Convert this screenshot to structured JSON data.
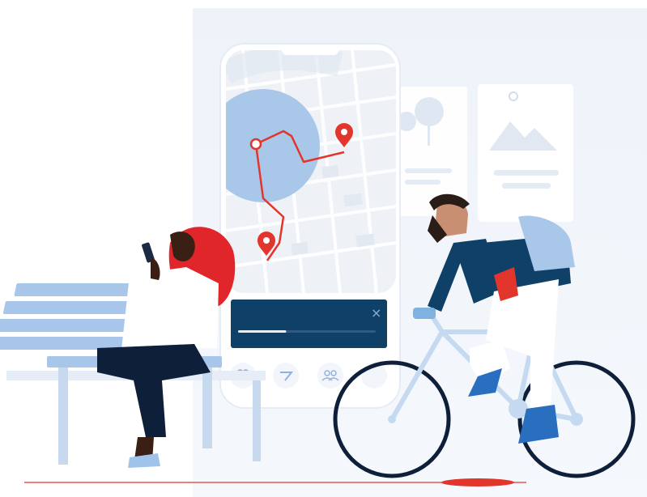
{
  "illustration": {
    "kind": "navigation-app-illustration",
    "route_color": "#e2352c",
    "accent_navy": "#0f4068",
    "light_blue": "#bcd3ec",
    "backdrop_blue": "#edf2fa",
    "pin_color": "#e2352c",
    "hair_color": "#e0262a"
  },
  "phone": {
    "icons": [
      "heart-icon",
      "bike-route-icon",
      "people-icon",
      "blank-circle-button"
    ]
  },
  "notification_card": {
    "close_glyph": "×",
    "progress": 0.35
  }
}
